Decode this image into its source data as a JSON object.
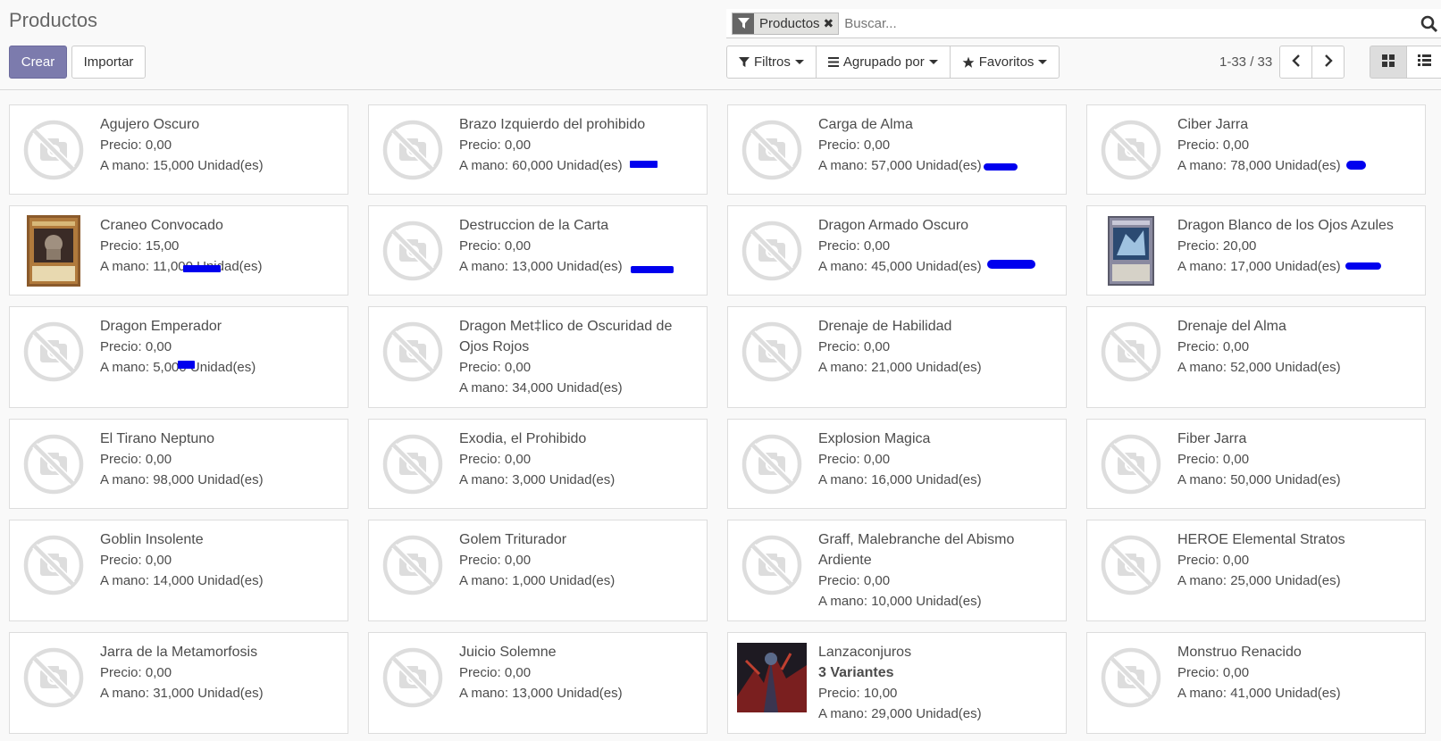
{
  "breadcrumb": "Productos",
  "buttons": {
    "create": "Crear",
    "import": "Importar"
  },
  "search": {
    "facet": "Productos",
    "placeholder": "Buscar..."
  },
  "filters": {
    "filters_label": "Filtros",
    "groupby_label": "Agrupado por",
    "favorites_label": "Favoritos"
  },
  "pager": {
    "value": "1-33 / 33"
  },
  "products": [
    {
      "name": "Agujero Oscuro",
      "price": "Precio: 0,00",
      "onhand": "A mano: 15,000 Unidad(es)",
      "image": "placeholder"
    },
    {
      "name": "Brazo Izquierdo del prohibido",
      "price": "Precio: 0,00",
      "onhand": "A mano: 60,000 Unidad(es)",
      "image": "placeholder"
    },
    {
      "name": "Carga de Alma",
      "price": "Precio: 0,00",
      "onhand": "A mano: 57,000 Unidad(es)",
      "image": "placeholder"
    },
    {
      "name": "Ciber Jarra",
      "price": "Precio: 0,00",
      "onhand": "A mano: 78,000 Unidad(es)",
      "image": "placeholder"
    },
    {
      "name": "Craneo Convocado",
      "price": "Precio: 15,00",
      "onhand": "A mano: 11,000 Unidad(es)",
      "image": "card-brown"
    },
    {
      "name": "Destruccion de la Carta",
      "price": "Precio: 0,00",
      "onhand": "A mano: 13,000 Unidad(es)",
      "image": "placeholder"
    },
    {
      "name": "Dragon Armado Oscuro",
      "price": "Precio: 0,00",
      "onhand": "A mano: 45,000 Unidad(es)",
      "image": "placeholder"
    },
    {
      "name": "Dragon Blanco de los Ojos Azules",
      "price": "Precio: 20,00",
      "onhand": "A mano: 17,000 Unidad(es)",
      "image": "card-blue"
    },
    {
      "name": "Dragon Emperador",
      "price": "Precio: 0,00",
      "onhand": "A mano: 5,000 Unidad(es)",
      "image": "placeholder"
    },
    {
      "name": "Dragon Met‡lico de Oscuridad de Ojos Rojos",
      "price": "Precio: 0,00",
      "onhand": "A mano: 34,000 Unidad(es)",
      "image": "placeholder"
    },
    {
      "name": "Drenaje de Habilidad",
      "price": "Precio: 0,00",
      "onhand": "A mano: 21,000 Unidad(es)",
      "image": "placeholder"
    },
    {
      "name": "Drenaje del Alma",
      "price": "Precio: 0,00",
      "onhand": "A mano: 52,000 Unidad(es)",
      "image": "placeholder"
    },
    {
      "name": "El Tirano Neptuno",
      "price": "Precio: 0,00",
      "onhand": "A mano: 98,000 Unidad(es)",
      "image": "placeholder"
    },
    {
      "name": "Exodia, el Prohibido",
      "price": "Precio: 0,00",
      "onhand": "A mano: 3,000 Unidad(es)",
      "image": "placeholder"
    },
    {
      "name": "Explosion Magica",
      "price": "Precio: 0,00",
      "onhand": "A mano: 16,000 Unidad(es)",
      "image": "placeholder"
    },
    {
      "name": "Fiber Jarra",
      "price": "Precio: 0,00",
      "onhand": "A mano: 50,000 Unidad(es)",
      "image": "placeholder"
    },
    {
      "name": "Goblin Insolente",
      "price": "Precio: 0,00",
      "onhand": "A mano: 14,000 Unidad(es)",
      "image": "placeholder"
    },
    {
      "name": "Golem Triturador",
      "price": "Precio: 0,00",
      "onhand": "A mano: 1,000 Unidad(es)",
      "image": "placeholder"
    },
    {
      "name": "Graff, Malebranche del Abismo Ardiente",
      "price": "Precio: 0,00",
      "onhand": "A mano: 10,000 Unidad(es)",
      "image": "placeholder"
    },
    {
      "name": "HEROE Elemental Stratos",
      "price": "Precio: 0,00",
      "onhand": "A mano: 25,000 Unidad(es)",
      "image": "placeholder"
    },
    {
      "name": "Jarra de la Metamorfosis",
      "price": "Precio: 0,00",
      "onhand": "A mano: 31,000 Unidad(es)",
      "image": "placeholder"
    },
    {
      "name": "Juicio Solemne",
      "price": "Precio: 0,00",
      "onhand": "A mano: 13,000 Unidad(es)",
      "image": "placeholder"
    },
    {
      "name": "Lanzaconjuros",
      "variants": "3 Variantes",
      "price": "Precio: 10,00",
      "onhand": "A mano: 29,000 Unidad(es)",
      "image": "art-dark"
    },
    {
      "name": "Monstruo Renacido",
      "price": "Precio: 0,00",
      "onhand": "A mano: 41,000 Unidad(es)",
      "image": "placeholder"
    }
  ],
  "colors": {
    "primary": "#7c7bad",
    "scribble": "#0000ee"
  }
}
